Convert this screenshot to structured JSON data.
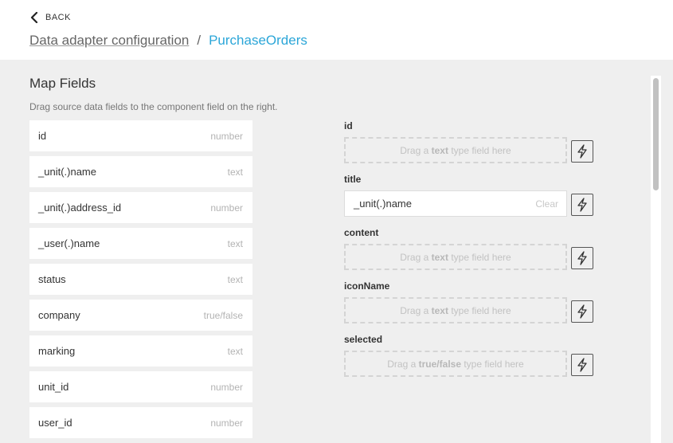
{
  "header": {
    "back_label": "BACK",
    "breadcrumb": {
      "parent": "Data adapter configuration",
      "separator": "/",
      "current": "PurchaseOrders"
    }
  },
  "map_fields": {
    "title": "Map Fields",
    "description": "Drag source data fields to the component field on the right.",
    "source_fields": [
      {
        "name": "id",
        "type": "number"
      },
      {
        "name": "_unit(.)name",
        "type": "text"
      },
      {
        "name": "_unit(.)address_id",
        "type": "number"
      },
      {
        "name": "_user(.)name",
        "type": "text"
      },
      {
        "name": "status",
        "type": "text"
      },
      {
        "name": "company",
        "type": "true/false"
      },
      {
        "name": "marking",
        "type": "text"
      },
      {
        "name": "unit_id",
        "type": "number"
      },
      {
        "name": "user_id",
        "type": "number"
      }
    ],
    "target_fields": [
      {
        "label": "id",
        "placeholder_pre": "Drag a",
        "placeholder_type": "text",
        "placeholder_post": "type field here"
      },
      {
        "label": "title",
        "value": "_unit(.)name",
        "clear_label": "Clear"
      },
      {
        "label": "content",
        "placeholder_pre": "Drag a",
        "placeholder_type": "text",
        "placeholder_post": "type field here"
      },
      {
        "label": "iconName",
        "placeholder_pre": "Drag a",
        "placeholder_type": "text",
        "placeholder_post": "type field here"
      },
      {
        "label": "selected",
        "placeholder_pre": "Drag a",
        "placeholder_type": "true/false",
        "placeholder_post": "type field here"
      }
    ]
  },
  "icons": {
    "back": "chevron-left-icon",
    "bind": "lightning-bolt-icon"
  },
  "colors": {
    "accent": "#2ba6d8",
    "panel_background": "#efefef",
    "dashed_border": "#d4d4d4"
  }
}
